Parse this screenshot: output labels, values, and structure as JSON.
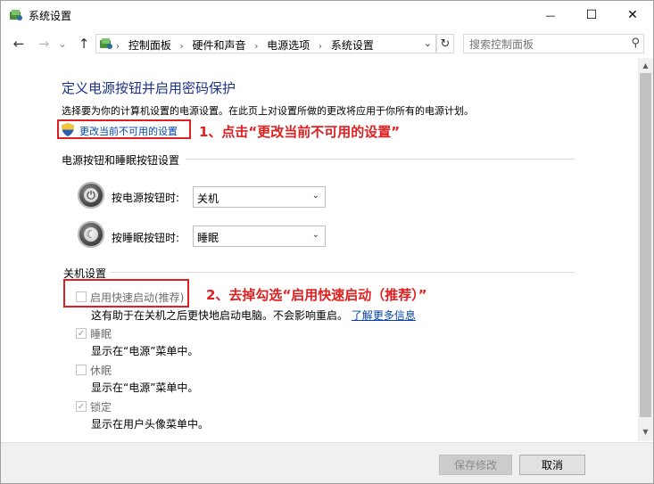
{
  "window": {
    "title": "系统设置",
    "controls": {
      "minimize": "—",
      "maximize": "☐",
      "close": "✕"
    }
  },
  "nav": {
    "back": "←",
    "forward": "→",
    "recent": "⌄",
    "up": "↑",
    "breadcrumbs": [
      "控制面板",
      "硬件和声音",
      "电源选项",
      "系统设置"
    ],
    "separator": "›",
    "dropdown": "⌄",
    "refresh": "↻",
    "search_placeholder": "搜索控制面板",
    "search_icon": "⚲"
  },
  "content": {
    "title": "定义电源按钮并启用密码保护",
    "intro": "选择要为你的计算机设置的电源设置。在此页上对设置所做的更改将应用于你所有的电源计划。",
    "change_link": "更改当前不可用的设置",
    "annotation1": "1、点击“更改当前不可用的设置”",
    "power_section": {
      "heading": "电源按钮和睡眠按钮设置",
      "rows": [
        {
          "label": "按电源按钮时:",
          "value": "关机",
          "icon": "power-icon"
        },
        {
          "label": "按睡眠按钮时:",
          "value": "睡眠",
          "icon": "sleep-icon"
        }
      ]
    },
    "shutdown_section": {
      "heading": "关机设置",
      "items": [
        {
          "label": "启用快速启动(推荐)",
          "checked": false,
          "desc": "这有助于在关机之后更快地启动电脑。不会影响重启。",
          "link": "了解更多信息"
        },
        {
          "label": "睡眠",
          "checked": true,
          "desc": "显示在“电源”菜单中。"
        },
        {
          "label": "休眠",
          "checked": false,
          "desc": "显示在“电源”菜单中。"
        },
        {
          "label": "锁定",
          "checked": true,
          "desc": "显示在用户头像菜单中。"
        }
      ]
    },
    "annotation2": "2、去掉勾选“启用快速启动（推荐）”"
  },
  "footer": {
    "save": "保存修改",
    "cancel": "取消"
  },
  "colors": {
    "title_blue": "#1e3287",
    "link_blue": "#0645ad",
    "annotation_red": "#e02020"
  }
}
